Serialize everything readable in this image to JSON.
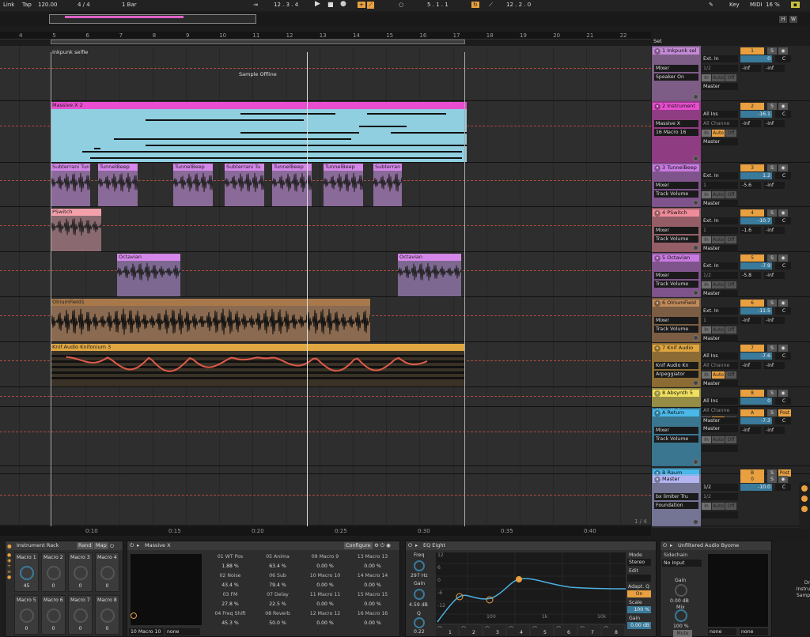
{
  "transport": {
    "link": "Link",
    "tap": "Tap",
    "tempo": "120.00",
    "meter": "4 / 4",
    "quant": "1 Bar",
    "position": "12 .  3 .  4",
    "loop_start": "5 .  1 .  1",
    "loop_len": "12 .  2 .  0",
    "key": "Key",
    "midi": "MIDI",
    "cpu": "16 %"
  },
  "overview": {
    "h": "H",
    "w": "W"
  },
  "ruler": {
    "bars": [
      "4",
      "5",
      "6",
      "7",
      "8",
      "9",
      "10",
      "11",
      "12",
      "13",
      "14",
      "15",
      "16",
      "17",
      "18",
      "19",
      "20",
      "21",
      "22"
    ],
    "times": [
      "0:10",
      "0:15",
      "0:20",
      "0:25",
      "0:30",
      "0:35",
      "0:40"
    ],
    "page": "1 / 4"
  },
  "set_label": "Set",
  "tracks": [
    {
      "name": "1 Inkpunk sel",
      "color": "#c58ad6",
      "clip": "Inkpunk selfie",
      "offline": "Sample Offline",
      "input": "Ext. In",
      "sub1": "1/2",
      "out": "Master",
      "dev1": "Mixer",
      "dev2": "Speaker On",
      "num": "1",
      "vol": "0",
      "pan": "C",
      "s1": "-inf",
      "s2": "-inf"
    },
    {
      "name": "2 Instrument",
      "color": "#e84ecf",
      "clip": "Massive X 2",
      "input": "All Ins",
      "sub1": "All Channe",
      "out": "Master",
      "dev1": "Massive X",
      "dev2": "16 Macro 16",
      "num": "2",
      "vol": "-16.1",
      "pan": "C",
      "s1": "-inf",
      "s2": "-inf"
    },
    {
      "name": "3 TunnelBeep",
      "color": "#c87ae0",
      "clips": [
        "Subterrani Tun",
        "TunnelBeep",
        "TunnelBeep",
        "Subterrani Tu",
        "TunnelBeep",
        "TunnelBeep",
        "Subterran"
      ],
      "input": "Ext. In",
      "sub1": "1",
      "out": "Master",
      "dev1": "Mixer",
      "dev2": "Track Volume",
      "num": "3",
      "vol": "1.2",
      "pan": "C",
      "s1": "-5.6",
      "s2": "-inf"
    },
    {
      "name": "4 PSwitch",
      "color": "#f08c9a",
      "clip": "PSwitch",
      "input": "Ext. In",
      "sub1": "1",
      "out": "Master",
      "dev1": "Mixer",
      "dev2": "Track Volume",
      "num": "4",
      "vol": "-10.7",
      "pan": "C",
      "s1": "-1.6",
      "s2": "-inf"
    },
    {
      "name": "5 Octavian",
      "color": "#c87ae0",
      "clips": [
        "Octavian",
        "Octavian"
      ],
      "input": "Ext. In",
      "sub1": "1/2",
      "out": "Master",
      "dev1": "Mixer",
      "dev2": "Track Volume",
      "num": "5",
      "vol": "-7.9",
      "pan": "C",
      "s1": "-5.8",
      "s2": "-inf"
    },
    {
      "name": "6 OlriumField",
      "color": "#c08a5a",
      "clip": "OlriumField1",
      "input": "Ext. In",
      "sub1": "1",
      "out": "Master",
      "dev1": "Mixer",
      "dev2": "Track Volume",
      "num": "6",
      "vol": "-11.5",
      "pan": "C",
      "s1": "-inf",
      "s2": "-inf"
    },
    {
      "name": "7 Knif Audio",
      "color": "#e0a640",
      "clip": "Knif Audio Knifonium 3",
      "input": "All Ins",
      "sub1": "All Channe",
      "out": "Master",
      "dev1": "Knif Audio Kn",
      "dev2": "Arpeggiator",
      "num": "7",
      "vol": "-7.6",
      "pan": "C",
      "s1": "-inf",
      "s2": "-inf"
    },
    {
      "name": "8 Absynth 5",
      "color": "#f0e060",
      "input": "All Ins",
      "sub1": "All Channe",
      "out": "Master",
      "dev1": "Absynth 5",
      "dev2": "",
      "num": "8",
      "vol": "0",
      "pan": "C",
      "s1": "",
      "s2": ""
    },
    {
      "name": "A Return",
      "color": "#4ab8e8",
      "input": "Master",
      "sub1": "",
      "out": "",
      "dev1": "Mixer",
      "dev2": "Track Volume",
      "num": "A",
      "vol": "-7.3",
      "pan": "C",
      "s1": "-inf",
      "s2": "-inf",
      "post": "Post"
    },
    {
      "name": "B Raum",
      "color": "#4ab8e8",
      "num": "B",
      "vol": "",
      "post": "Post"
    },
    {
      "name": "Master",
      "color": "#b4b4f0",
      "input": "1/2",
      "sub1": "1/2",
      "dev1": "bx limiter Tru",
      "dev2": "Foundation",
      "num": "0",
      "vol": "-10.0",
      "pan": "C"
    }
  ],
  "mixer_labels": {
    "in": "In",
    "auto": "Auto",
    "off": "Off",
    "s": "S"
  },
  "rack": {
    "title": "Instrument Rack",
    "rand": "Rand",
    "map": "Map",
    "macros": [
      {
        "n": "Macro 1",
        "v": "45"
      },
      {
        "n": "Macro 2",
        "v": "0"
      },
      {
        "n": "Macro 3",
        "v": "0"
      },
      {
        "n": "Macro 4",
        "v": "0"
      },
      {
        "n": "Macro 5",
        "v": "0"
      },
      {
        "n": "Macro 6",
        "v": "0"
      },
      {
        "n": "Macro 7",
        "v": "0"
      },
      {
        "n": "Macro 8",
        "v": "0"
      }
    ]
  },
  "massive": {
    "title": "Massive X",
    "configure": "Configure",
    "sel1": "10 Macro 10",
    "sel2": "none",
    "params": [
      [
        "01 WT Pos",
        "05 Anima",
        "09 Macro 9",
        "13 Macro 13"
      ],
      [
        "1.88 %",
        "63.4 %",
        "0.00 %",
        "0.00 %"
      ],
      [
        "02 Noise",
        "06 Sub",
        "10 Macro 10",
        "14 Macro 14"
      ],
      [
        "43.4 %",
        "79.4 %",
        "0.00 %",
        "0.00 %"
      ],
      [
        "03 FM",
        "07 Delay",
        "11 Macro 11",
        "15 Macro 15"
      ],
      [
        "27.8 %",
        "22.5 %",
        "0.00 %",
        "0.00 %"
      ],
      [
        "04 Freq Shift",
        "08 Reverb",
        "12 Macro 12",
        "16 Macro 16"
      ],
      [
        "45.3 %",
        "50.0 %",
        "0.00 %",
        "0.00 %"
      ]
    ]
  },
  "eq": {
    "title": "EQ Eight",
    "freq": "Freq",
    "freq_val": "297 Hz",
    "gain": "Gain",
    "gain_val": "4.59 dB",
    "q": "Q",
    "q_val": "0.22",
    "mode": "Mode",
    "mode_val": "Stereo",
    "edit": "Edit",
    "adapt": "Adapt. Q",
    "on": "On",
    "scale": "Scale",
    "scale_val": "100 %",
    "gain2": "Gain",
    "gain2_val": "0.00 dB",
    "y_labels": [
      "12",
      "6",
      "0",
      "-6",
      "-12"
    ],
    "x_labels": [
      "100",
      "1k",
      "10k"
    ],
    "bands": [
      "1",
      "2",
      "3",
      "4",
      "5",
      "6",
      "7",
      "8"
    ]
  },
  "byome": {
    "title": "Unfiltered Audio Byome",
    "sidechain": "Sidechain",
    "no_input": "No Input",
    "gain": "Gain",
    "gain_val": "0.00 dB",
    "mix": "Mix",
    "mix_val": "100 %",
    "mute": "Mute",
    "sel1": "none",
    "sel2": "none",
    "side_text": "Dr\nInstru\nSamp"
  }
}
